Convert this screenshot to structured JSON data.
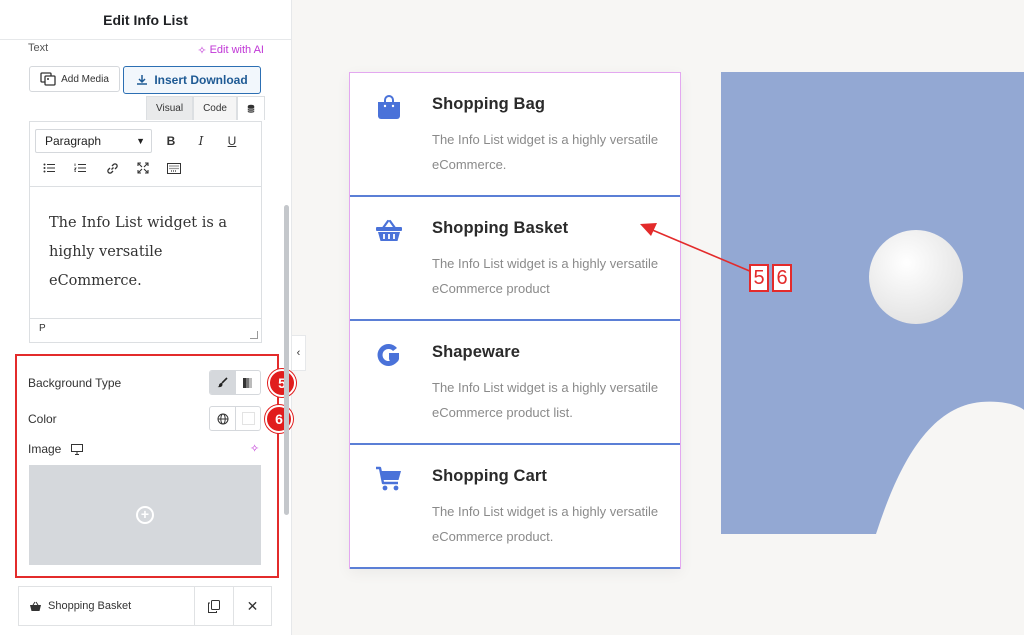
{
  "panel": {
    "title": "Edit Info List",
    "text_label": "Text",
    "ai_link": "Edit with AI",
    "add_media": "Add Media",
    "insert_download": "Insert Download",
    "tabs": [
      "Visual",
      "Code"
    ],
    "paragraph_select": "Paragraph",
    "editor_text": "The Info List widget is a highly versatile eCommerce.",
    "status_tag": "P",
    "background_type_label": "Background Type",
    "color_label": "Color",
    "image_label": "Image",
    "badge_5": "5",
    "badge_6": "6",
    "bottom_item": "Shopping Basket"
  },
  "canvas": {
    "items": [
      {
        "title": "Shopping Bag",
        "desc": "The Info List widget is a highly versatile eCommerce.",
        "icon": "shopping-bag-icon"
      },
      {
        "title": "Shopping Basket",
        "desc": "The Info List widget is a highly versatile eCommerce product",
        "icon": "shopping-basket-icon"
      },
      {
        "title": "Shapeware",
        "desc": "The Info List widget is a highly versatile eCommerce product list.",
        "icon": "shapeware-icon"
      },
      {
        "title": "Shopping Cart",
        "desc": "The Info List widget is a highly versatile eCommerce product.",
        "icon": "shopping-cart-icon"
      }
    ],
    "step_labels": [
      "5",
      "6"
    ]
  },
  "colors": {
    "accent_blue": "#4a72d9",
    "highlight_red": "#e32b2b",
    "placeholder_bg": "#93a8d3",
    "ai_purple": "#c036d6"
  }
}
